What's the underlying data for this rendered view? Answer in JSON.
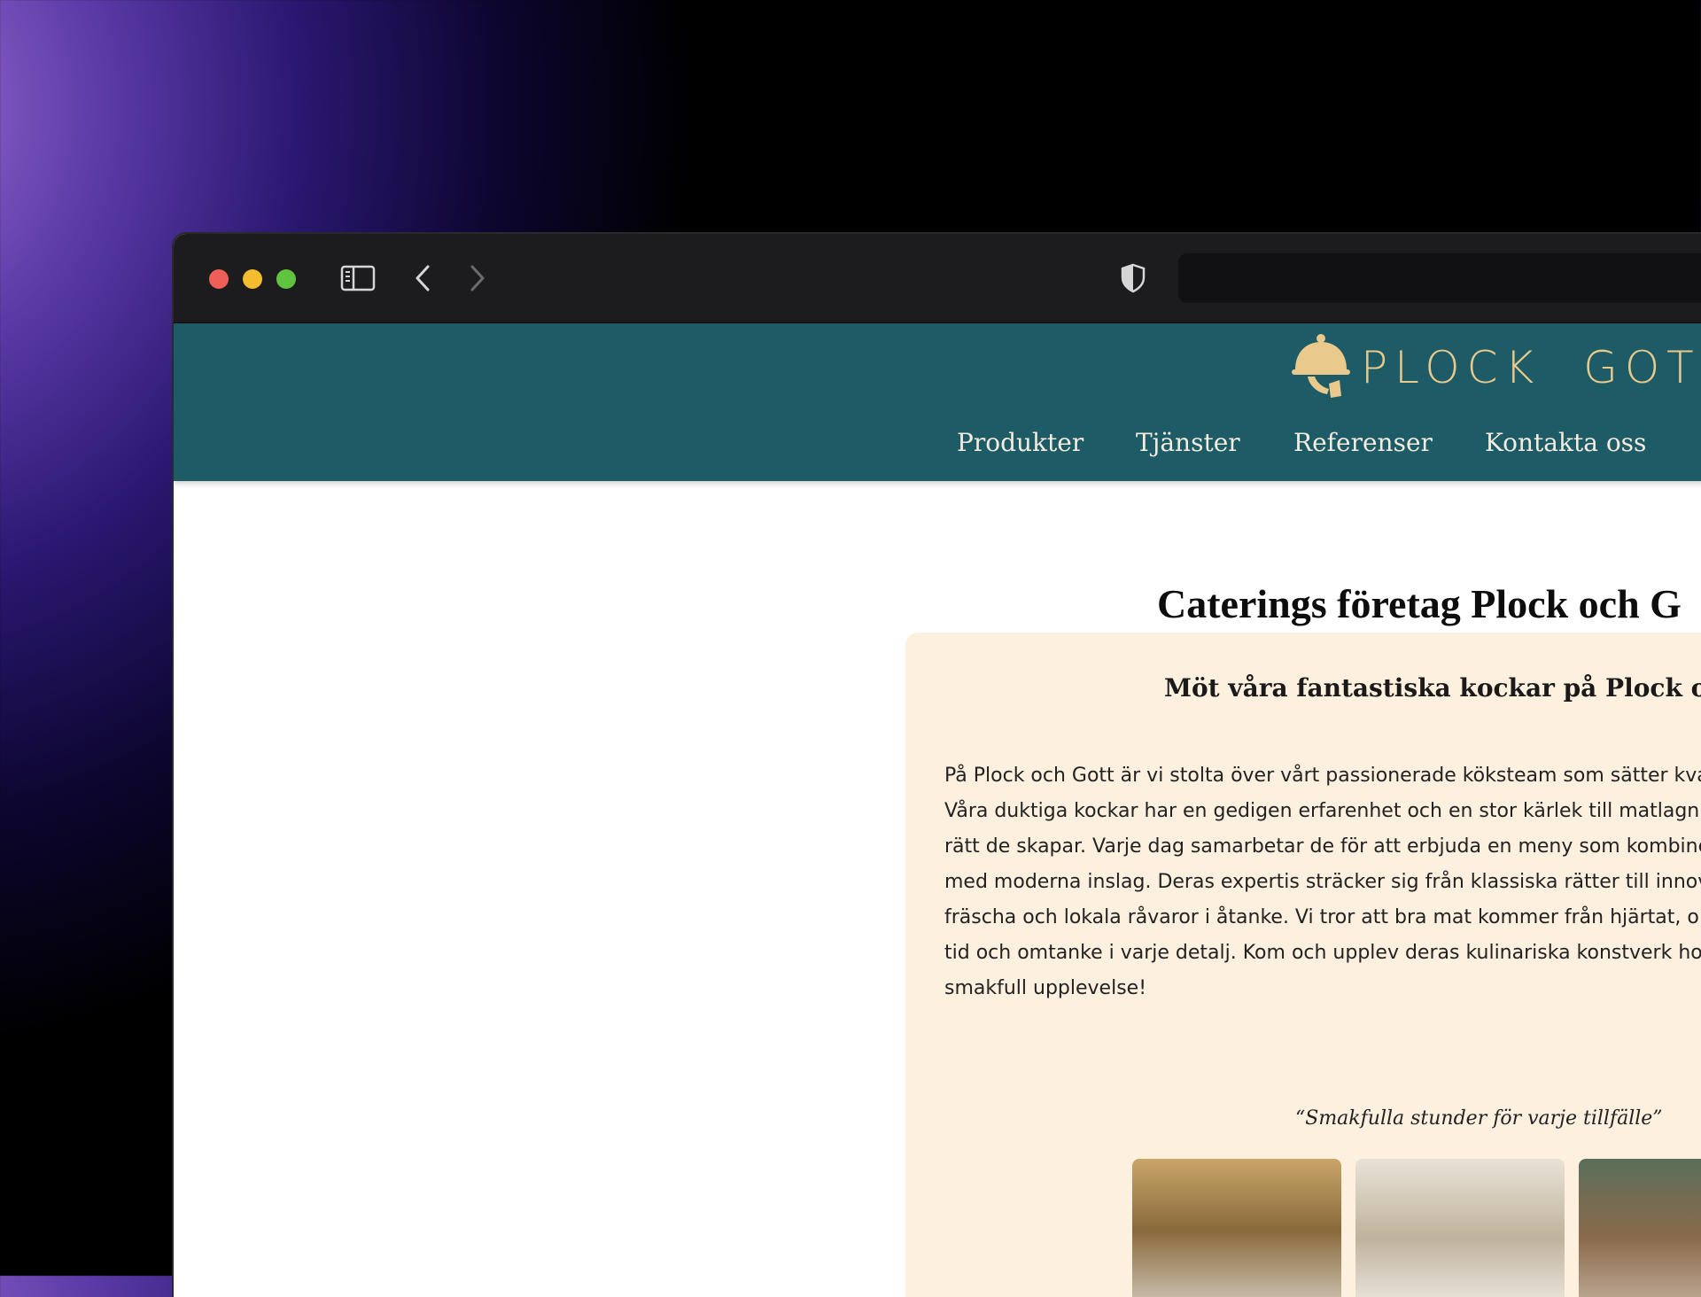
{
  "browser": {
    "icons": [
      "sidebar-icon",
      "back-icon",
      "forward-icon",
      "shield-icon"
    ]
  },
  "site": {
    "logo_text": "PLOCK  GOTT",
    "brand_colors": {
      "header": "#1d5b66",
      "logo": "#e9c98c",
      "card": "#fdf0df"
    },
    "nav": [
      {
        "label": "Produkter"
      },
      {
        "label": "Tjänster"
      },
      {
        "label": "Referenser"
      },
      {
        "label": "Kontakta oss"
      }
    ]
  },
  "main": {
    "title": "Caterings företag Plock och G",
    "card": {
      "heading": "Möt våra fantastiska kockar på Plock och G",
      "lines": [
        "På Plock och Gott är vi stolta över vårt passionerade köksteam som sätter kval",
        "Våra duktiga kockar har en gedigen erfarenhet och en stor kärlek till matlagni",
        "rätt de skapar. Varje dag samarbetar de för att erbjuda en meny som kombiner",
        "med moderna inslag. Deras expertis sträcker sig från klassiska rätter till innov",
        "fräscha och lokala råvaror i åtanke. Vi tror att bra mat kommer från hjärtat, o",
        "tid och omtanke i varje detalj. Kom och upplev deras kulinariska konstverk hos",
        "smakfull upplevelse!"
      ],
      "quote": "“Smakfulla stunder för varje tillfälle”"
    }
  }
}
